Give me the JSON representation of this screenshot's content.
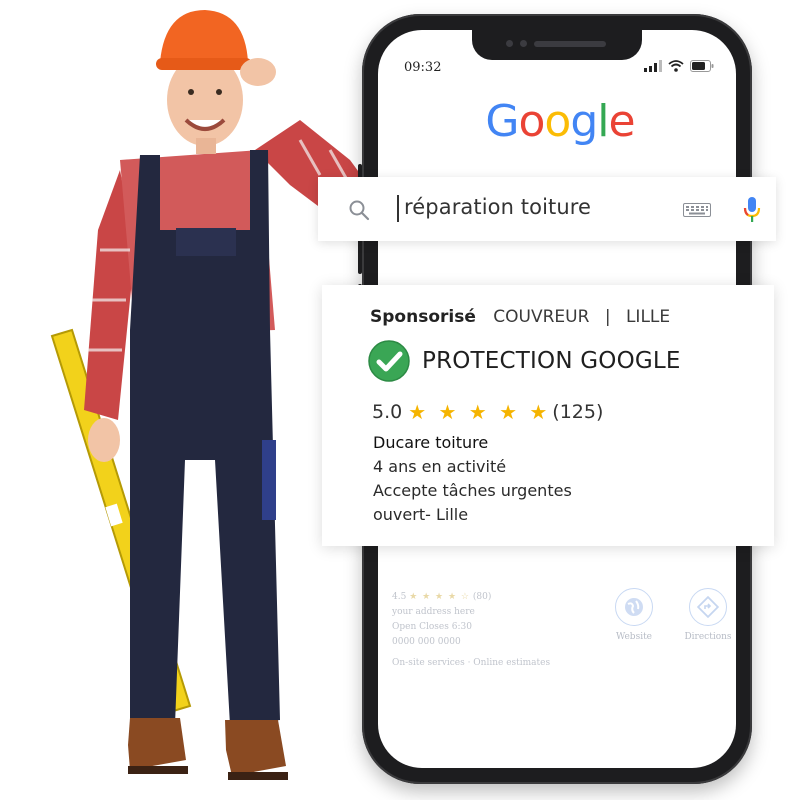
{
  "status_bar": {
    "time": "09:32"
  },
  "google_logo": [
    "G",
    "o",
    "o",
    "g",
    "l",
    "e"
  ],
  "colors": {
    "blue": "#4285F4",
    "red": "#EA4335",
    "yellow": "#FBBC05",
    "green": "#34A853"
  },
  "search": {
    "query": "réparation toiture"
  },
  "result": {
    "sponsored": "Sponsorisé",
    "category": "COUVREUR",
    "separator": "|",
    "city": "LILLE",
    "badge": "PROTECTION GOOGLE",
    "rating_value": "5.0",
    "stars": "★ ★ ★ ★ ★",
    "review_count": "(125)",
    "business_name": "Ducare toiture",
    "years": "4 ans en activité",
    "urgent": "Accepte tâches urgentes",
    "open": "ouvert- Lille"
  },
  "faded": {
    "rating": "4.5",
    "stars": "★ ★ ★ ★ ☆",
    "count": "(80)",
    "address": "your address here",
    "hours": "Open Closes 6:30",
    "phone": "0000 000 0000",
    "services": "On-site services · Online estimates",
    "website_label": "Website",
    "directions_label": "Directions"
  }
}
